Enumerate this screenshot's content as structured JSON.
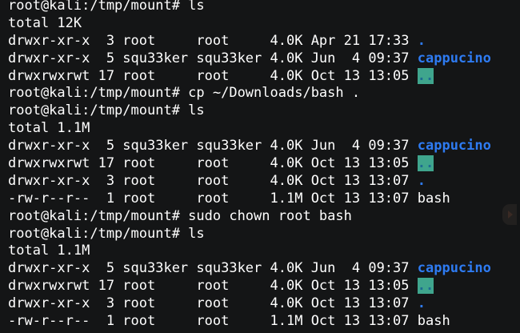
{
  "terminal": {
    "lines": [
      {
        "text": "root@kali:/tmp/mount# ls"
      },
      {
        "text": "total 12K"
      },
      {
        "text": "drwxr-xr-x  3 root     root     4.0K Apr 21 17:33 ",
        "name": ".",
        "style": "blue"
      },
      {
        "text": "drwxr-xr-x  5 squ33ker squ33ker 4.0K Jun  4 09:37 ",
        "name": "cappucino",
        "style": "blue"
      },
      {
        "text": "drwxrwxrwt 17 root     root     4.0K Oct 13 13:05 ",
        "name": "..",
        "style": "sticky"
      },
      {
        "text": "root@kali:/tmp/mount# cp ~/Downloads/bash ."
      },
      {
        "text": "root@kali:/tmp/mount# ls"
      },
      {
        "text": "total 1.1M"
      },
      {
        "text": "drwxr-xr-x  5 squ33ker squ33ker 4.0K Jun  4 09:37 ",
        "name": "cappucino",
        "style": "blue"
      },
      {
        "text": "drwxrwxrwt 17 root     root     4.0K Oct 13 13:05 ",
        "name": "..",
        "style": "sticky"
      },
      {
        "text": "drwxr-xr-x  3 root     root     4.0K Oct 13 13:07 ",
        "name": ".",
        "style": "blue"
      },
      {
        "text": "-rw-r--r--  1 root     root     1.1M Oct 13 13:07 ",
        "name": "bash",
        "style": "plain"
      },
      {
        "text": "root@kali:/tmp/mount# sudo chown root bash"
      },
      {
        "text": "root@kali:/tmp/mount# ls"
      },
      {
        "text": "total 1.1M"
      },
      {
        "text": "drwxr-xr-x  5 squ33ker squ33ker 4.0K Jun  4 09:37 ",
        "name": "cappucino",
        "style": "blue"
      },
      {
        "text": "drwxrwxrwt 17 root     root     4.0K Oct 13 13:05 ",
        "name": "..",
        "style": "sticky"
      },
      {
        "text": "drwxr-xr-x  3 root     root     4.0K Oct 13 13:07 ",
        "name": ".",
        "style": "blue"
      },
      {
        "text": "-rw-r--r--  1 root     root     1.1M Oct 13 13:07 ",
        "name": "bash",
        "style": "plain"
      }
    ]
  },
  "colors": {
    "background": "#141516",
    "text": "#ffffff",
    "directory": "#2e7bf2",
    "sticky_bg": "#3fa58d",
    "sticky_fg": "#1c6b93"
  },
  "icons": {
    "side_handle": "play-triangle-icon"
  }
}
